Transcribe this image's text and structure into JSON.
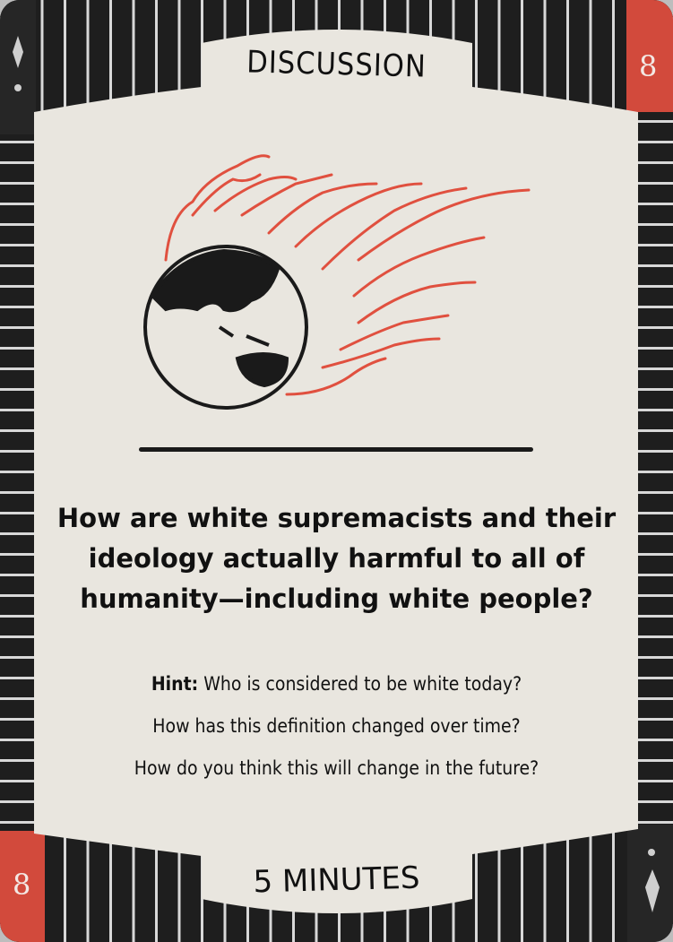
{
  "card": {
    "category": "DISCUSSION",
    "number": "8",
    "question_lines": [
      "How are white supremacists and their",
      "ideology actually harmful to all of",
      "humanity—including white people?"
    ],
    "hint_label": "Hint:",
    "hint_lines": [
      " Who is considered to be white today?",
      "How has this definition changed over time?",
      "How do you think this will change in the future?"
    ],
    "duration": "5 MINUTES",
    "illustration_icon": "flaming-globe-icon",
    "colors": {
      "accent_red": "#d24a3c",
      "cream": "#e9e6df",
      "black": "#1e1e1e"
    }
  }
}
